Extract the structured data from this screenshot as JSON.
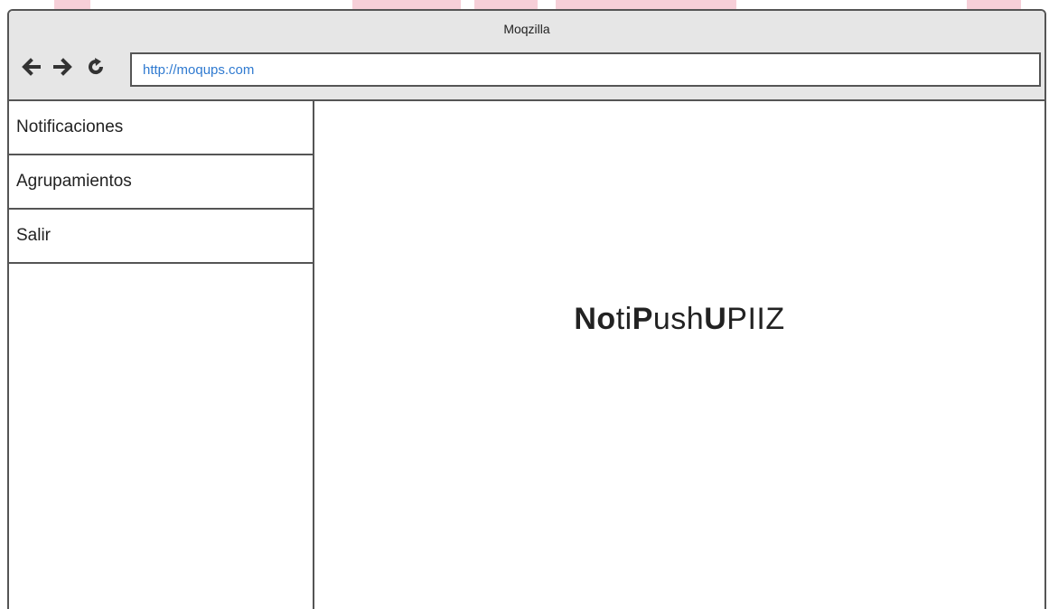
{
  "window": {
    "title": "Moqzilla"
  },
  "toolbar": {
    "back_icon": "arrow-left-icon",
    "forward_icon": "arrow-right-icon",
    "reload_icon": "reload-icon",
    "url": "http://moqups.com"
  },
  "sidebar": {
    "items": [
      {
        "label": "Notificaciones"
      },
      {
        "label": "Agrupamientos"
      },
      {
        "label": "Salir"
      }
    ]
  },
  "main": {
    "brand_parts": [
      "No",
      "ti",
      "P",
      "ush",
      "U",
      "PIIZ"
    ]
  },
  "colors": {
    "url_text": "#2f7ad0",
    "chrome": "#e6e6e6",
    "border": "#555555",
    "artifact": "#f6cfd8"
  }
}
